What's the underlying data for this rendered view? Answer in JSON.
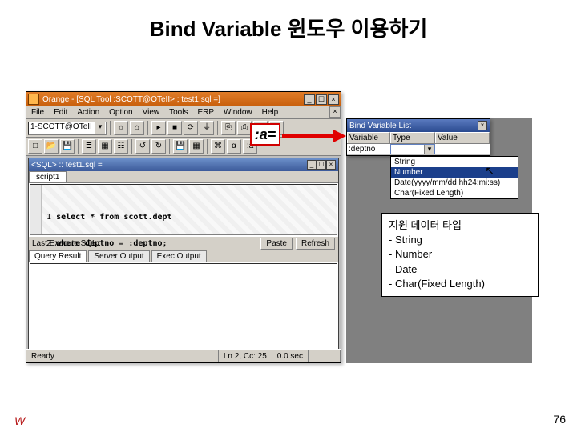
{
  "slide": {
    "title": "Bind Variable 윈도우 이용하기",
    "page": "76"
  },
  "orange": {
    "title": "Orange - [SQL Tool :SCOTT@OTeII> ; test1.sql =]",
    "menu": [
      "File",
      "Edit",
      "Action",
      "Option",
      "View",
      "Tools",
      "ERP",
      "Window",
      "Help"
    ],
    "combo_schema": "1-SCOTT@OTeII",
    "inner_title": "<SQL> :: test1.sql =",
    "tab": "script1",
    "sql_line1": "1",
    "sql_text1": "select * from scott.dept",
    "sql_line2": "2",
    "sql_text2": "where deptno = :deptno;",
    "last_exec_label": "Last Execute SQL :",
    "btn_paste": "Paste",
    "btn_refresh": "Refresh",
    "result_tabs": [
      "Query Result",
      "Server Output",
      "Exec Output"
    ],
    "status_ready": "Ready",
    "status_pos": "Ln 2, Cc: 25",
    "status_time": "0.0 sec"
  },
  "callout": {
    "a": ":a="
  },
  "bvl": {
    "title": "Bind Variable List",
    "col_var": "Variable",
    "col_type": "Type",
    "col_val": "Value",
    "row_var": ":deptno",
    "options": [
      "String",
      "Number",
      "Date(yyyy/mm/dd hh24:mi:ss)",
      "Char(Fixed Length)"
    ],
    "selected": "Number"
  },
  "info": {
    "title": "지원 데이터 타입",
    "line1": "- String",
    "line2": "- Number",
    "line3": "- Date",
    "line4": "- Char(Fixed Length)"
  },
  "chart_data": {
    "type": "table",
    "title": "Bind Variable List — supported data types",
    "columns": [
      "Variable",
      "Type",
      "Value"
    ],
    "rows": [
      [
        ":deptno",
        "(dropdown)",
        ""
      ]
    ],
    "dropdown_options": [
      "String",
      "Number",
      "Date(yyyy/mm/dd hh24:mi:ss)",
      "Char(Fixed Length)"
    ],
    "selected_option": "Number"
  }
}
